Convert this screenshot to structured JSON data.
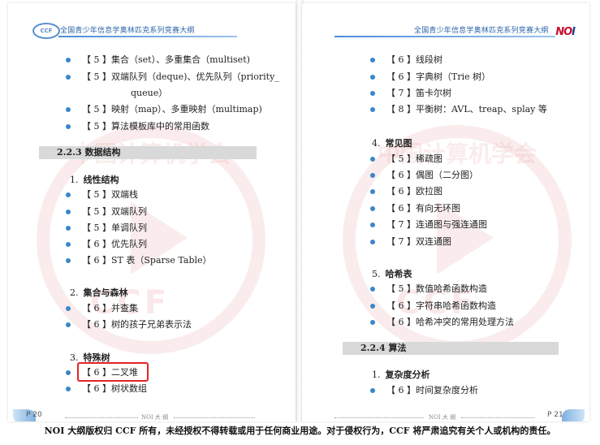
{
  "header": {
    "left_title": "全国青少年信息学奥林匹克系列竞赛大纲",
    "right_title": "全国青少年信息学奥林匹克系列竞赛大纲",
    "left_logo": "CCF",
    "right_logo_a": "NO",
    "right_logo_b": "I",
    "logo_color": "#c8102e"
  },
  "watermark": {
    "text": "中国计算机学会",
    "ccf": "CCF"
  },
  "left": {
    "items_top": [
      "【 5 】集合（set）、多重集合（multiset)",
      "【 5 】双端队列（deque)、优先队列（priority_",
      "queue）",
      "【 5 】映射（map）、多重映射（multimap)",
      "【 5 】算法模板库中的常用函数"
    ],
    "section": "2.2.3 数据结构",
    "g1_num": "1.",
    "g1_title": "线性结构",
    "g1_items": [
      "【 5 】双端栈",
      "【 5 】双端队列",
      "【 5 】单调队列",
      "【 6 】优先队列",
      "【 6 】ST 表（Sparse Table）"
    ],
    "g2_num": "2.",
    "g2_title": "集合与森林",
    "g2_items": [
      "【 6 】并查集",
      "【 6 】树的孩子兄弟表示法"
    ],
    "g3_num": "3.",
    "g3_title": "特殊树",
    "g3_items": [
      "【 6 】二叉堆",
      "【 6 】树状数组"
    ],
    "footer_page": "P 20",
    "footer_mid": "NOI 大 纲"
  },
  "right": {
    "items_top": [
      "【 6 】线段树",
      "【 6 】字典树（Trie 树）",
      "【 7 】笛卡尔树",
      "【 8 】平衡树：AVL、treap、splay 等"
    ],
    "g4_num": "4.",
    "g4_title": "常见图",
    "g4_items": [
      "【 5 】稀疏图",
      "【 6 】偶图（二分图）",
      "【 6 】欧拉图",
      "【 6 】有向无环图",
      "【 7 】连通图与强连通图",
      "【 7 】双连通图"
    ],
    "g5_num": "5.",
    "g5_title": "哈希表",
    "g5_items": [
      "【 5 】数值哈希函数构造",
      "【 6 】字符串哈希函数构造",
      "【 6 】哈希冲突的常用处理方法"
    ],
    "section": "2.2.4 算法",
    "g6_num": "1.",
    "g6_title": "复杂度分析",
    "g6_items": [
      "【 6 】时间复杂度分析"
    ],
    "footer_page": "P 21",
    "footer_mid": "NOI 大 纲"
  },
  "copyright": "NOI 大纲版权归 CCF 所有，未经授权不得转载或用于任何商业用途。对于侵权行为，CCF 将严肃追究有关个人或机构的责任。",
  "colors": {
    "bullet": "#3a86c8",
    "header": "#2a63a8",
    "highlight": "#e22424",
    "section_bg": "#d9d9d9"
  },
  "icons": [
    "ccf-logo-icon",
    "noi-logo-icon",
    "bullet-dot-icon",
    "wing-decoration-icon"
  ]
}
